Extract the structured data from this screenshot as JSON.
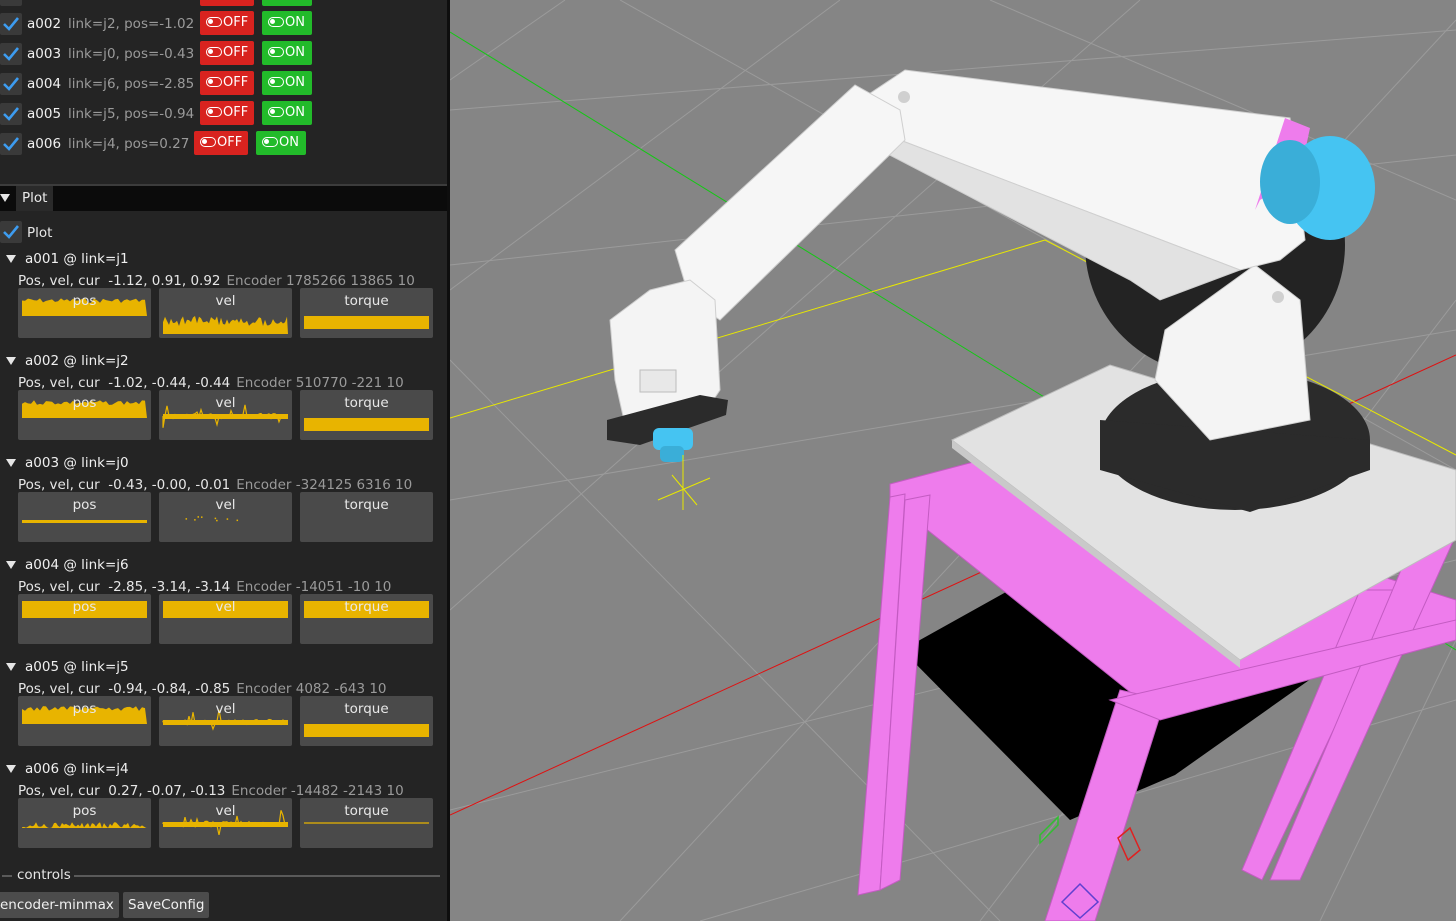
{
  "actuators": [
    {
      "name": "a002",
      "info": "link=j2, pos=-1.02",
      "off_label": "OFF",
      "on_label": "ON"
    },
    {
      "name": "a003",
      "info": "link=j0, pos=-0.43",
      "off_label": "OFF",
      "on_label": "ON"
    },
    {
      "name": "a004",
      "info": "link=j6, pos=-2.85",
      "off_label": "OFF",
      "on_label": "ON"
    },
    {
      "name": "a005",
      "info": "link=j5, pos=-0.94",
      "off_label": "OFF",
      "on_label": "ON"
    },
    {
      "name": "a006",
      "info": "link=j4, pos=0.27",
      "off_label": "OFF",
      "on_label": "ON"
    }
  ],
  "plot_panel": {
    "tab_label": "Plot",
    "checkbox_label": "Plot",
    "sections": [
      {
        "title": "a001 @ link=j1",
        "values_label": "Pos, vel, cur",
        "values": "-1.12, 0.91, 0.92",
        "encoder": "Encoder 1785266 13865 10"
      },
      {
        "title": "a002 @ link=j2",
        "values_label": "Pos, vel, cur",
        "values": "-1.02, -0.44, -0.44",
        "encoder": "Encoder 510770 -221 10"
      },
      {
        "title": "a003 @ link=j0",
        "values_label": "Pos, vel, cur",
        "values": "-0.43, -0.00, -0.01",
        "encoder": "Encoder -324125 6316 10"
      },
      {
        "title": "a004 @ link=j6",
        "values_label": "Pos, vel, cur",
        "values": "-2.85, -3.14, -3.14",
        "encoder": "Encoder -14051 -10 10"
      },
      {
        "title": "a005 @ link=j5",
        "values_label": "Pos, vel, cur",
        "values": "-0.94, -0.84, -0.85",
        "encoder": "Encoder 4082 -643 10"
      },
      {
        "title": "a006 @ link=j4",
        "values_label": "Pos, vel, cur",
        "values": "0.27, -0.07, -0.13",
        "encoder": "Encoder -14482 -2143 10"
      }
    ],
    "plot_labels": {
      "pos": "pos",
      "vel": "vel",
      "torque": "torque"
    },
    "plot_color": "#e8b400"
  },
  "controls": {
    "title": "controls",
    "buttons": [
      "encoder-minmax",
      "SaveConfig"
    ]
  },
  "viewport": {
    "background": "#858585",
    "gripper_color": "#45c4f2",
    "frame_color": "#ee7cec"
  }
}
